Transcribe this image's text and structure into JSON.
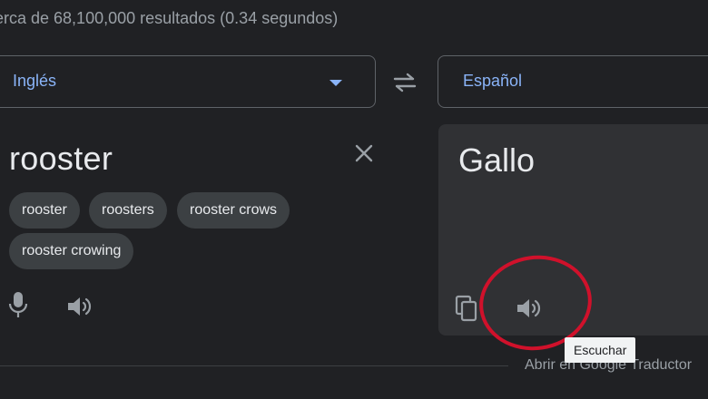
{
  "search": {
    "results_stats": "erca de 68,100,000 resultados (0.34 segundos)"
  },
  "translator": {
    "source_language": "Inglés",
    "target_language": "Español",
    "source_text": "rooster",
    "translated_text": "Gallo",
    "suggestions": [
      "rooster",
      "roosters",
      "rooster crows",
      "rooster crowing"
    ],
    "tooltip": "Escuchar",
    "open_link": "Abrir en Google Traductor"
  },
  "colors": {
    "background": "#202124",
    "panel": "#303134",
    "accent_blue": "#8ab4f8",
    "chip": "#3c4043",
    "annotation_red": "#d0112b"
  },
  "icons": {
    "swap": "swap-arrows-icon",
    "clear": "close-icon",
    "mic": "microphone-icon",
    "speaker": "speaker-icon",
    "copy": "copy-icon",
    "dropdown": "dropdown-arrow-icon"
  }
}
